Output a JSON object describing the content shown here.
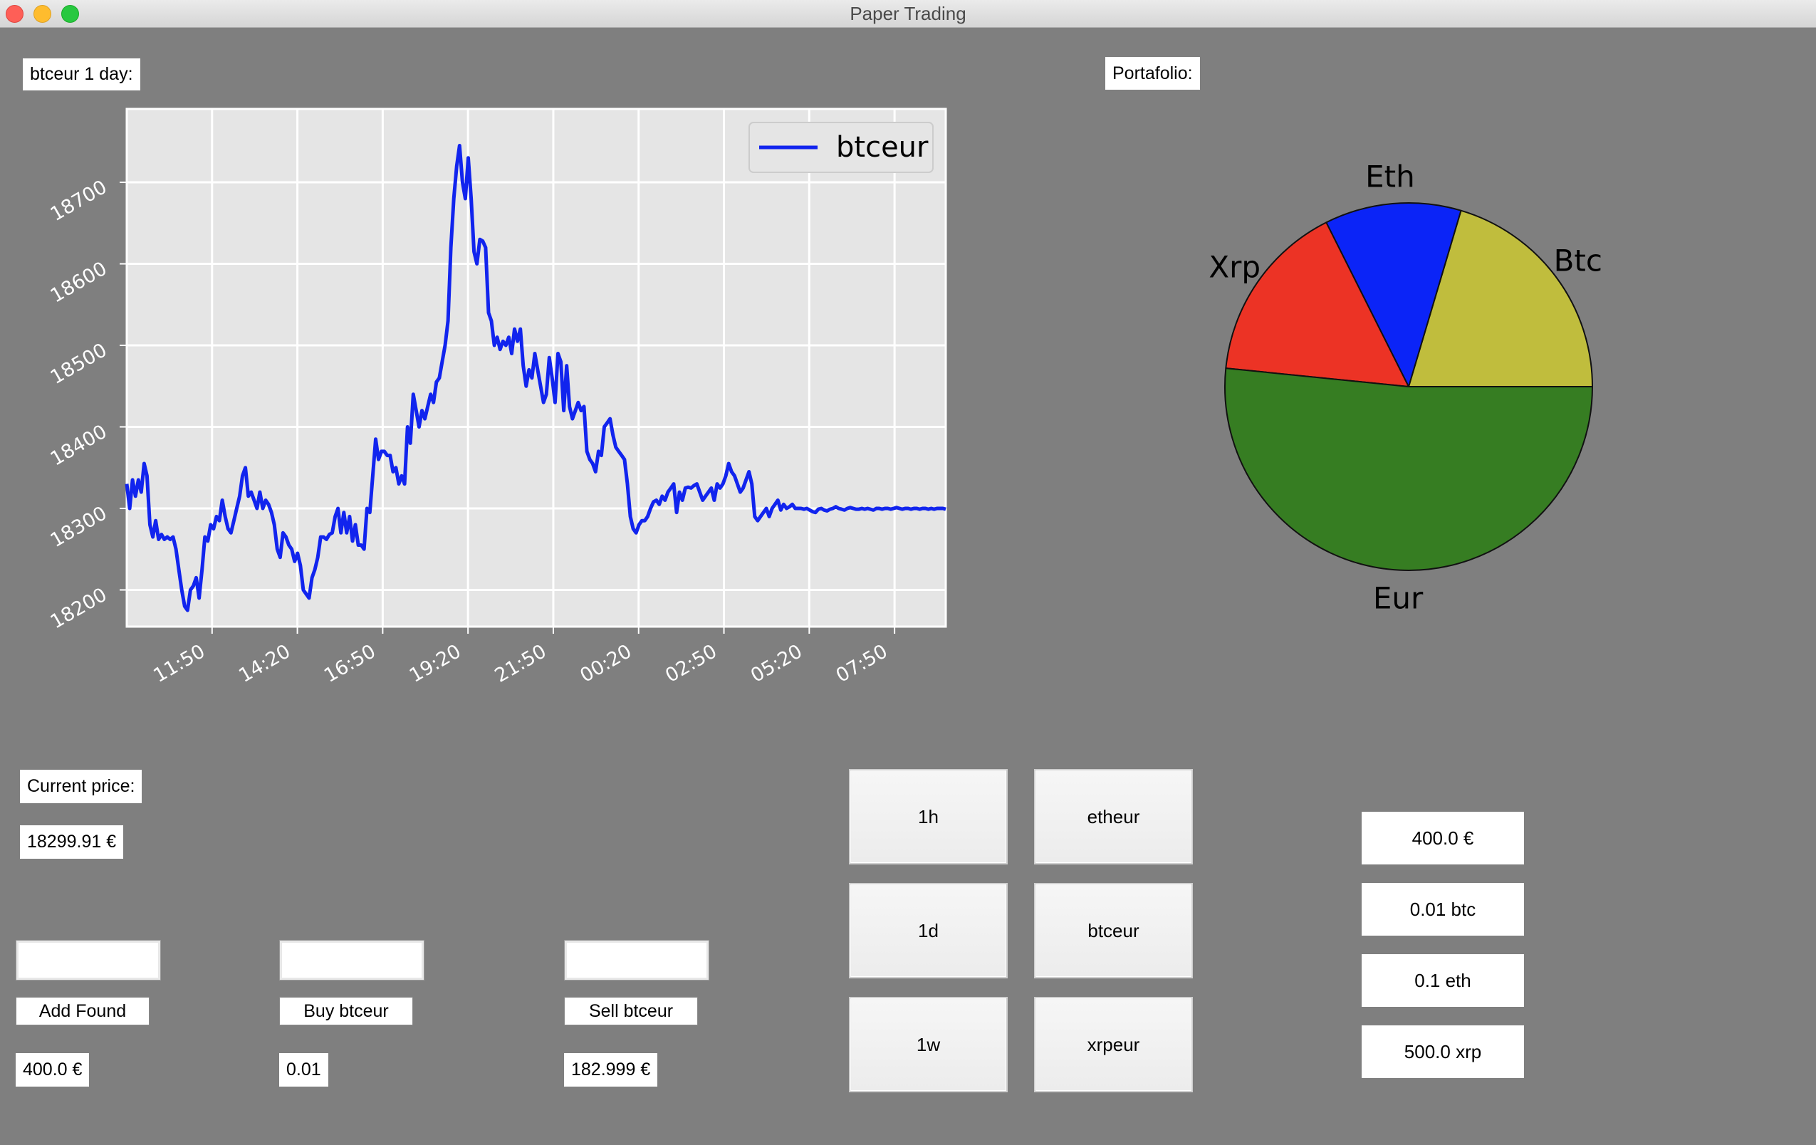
{
  "window": {
    "title": "Paper Trading"
  },
  "line_panel": {
    "label": "btceur 1 day:"
  },
  "portfolio_panel": {
    "label": "Portafolio:"
  },
  "price": {
    "label": "Current price:",
    "value": "18299.91 €"
  },
  "actions": {
    "fund": {
      "button": "Add Found",
      "value": "400.0 €",
      "input_value": ""
    },
    "buy": {
      "button": "Buy btceur",
      "value": "0.01",
      "input_value": ""
    },
    "sell": {
      "button": "Sell btceur",
      "value": "182.999 €",
      "input_value": ""
    }
  },
  "timeframes": [
    "1h",
    "1d",
    "1w"
  ],
  "pairs": [
    "etheur",
    "btceur",
    "xrpeur"
  ],
  "holdings": [
    "400.0 €",
    "0.01 btc",
    "0.1 eth",
    "500.0 xrp"
  ],
  "colors": {
    "background": "#7f7f7f",
    "plot_bg": "#e5e5e5",
    "line": "#1124ee",
    "eur": "#367d22",
    "xrp": "#ec3325",
    "eth": "#0b24f7",
    "btc": "#c0bd3d"
  },
  "chart_data": [
    {
      "type": "line",
      "title": "",
      "xlabel": "",
      "ylabel": "",
      "ylim": [
        18155,
        18790
      ],
      "yticks": [
        18200,
        18300,
        18400,
        18500,
        18600,
        18700
      ],
      "xlim": [
        0,
        288
      ],
      "x_ticks": [
        {
          "pos": 30,
          "label": "11:50"
        },
        {
          "pos": 60,
          "label": "14:20"
        },
        {
          "pos": 90,
          "label": "16:50"
        },
        {
          "pos": 120,
          "label": "19:20"
        },
        {
          "pos": 150,
          "label": "21:50"
        },
        {
          "pos": 180,
          "label": "00:20"
        },
        {
          "pos": 210,
          "label": "02:50"
        },
        {
          "pos": 240,
          "label": "05:20"
        },
        {
          "pos": 270,
          "label": "07:50"
        }
      ],
      "grid": true,
      "legend": "top-right",
      "series": [
        {
          "name": "btceur",
          "values": [
            18330,
            18300,
            18335,
            18315,
            18335,
            18320,
            18355,
            18340,
            18280,
            18265,
            18285,
            18262,
            18268,
            18262,
            18265,
            18262,
            18265,
            18250,
            18225,
            18200,
            18180,
            18175,
            18200,
            18205,
            18215,
            18190,
            18225,
            18265,
            18260,
            18280,
            18275,
            18290,
            18285,
            18310,
            18290,
            18275,
            18270,
            18285,
            18300,
            18315,
            18340,
            18350,
            18315,
            18320,
            18310,
            18300,
            18320,
            18300,
            18310,
            18305,
            18295,
            18280,
            18250,
            18240,
            18270,
            18265,
            18255,
            18250,
            18235,
            18245,
            18230,
            18200,
            18195,
            18190,
            18215,
            18225,
            18240,
            18265,
            18265,
            18262,
            18268,
            18270,
            18290,
            18300,
            18270,
            18295,
            18270,
            18290,
            18260,
            18280,
            18255,
            18255,
            18250,
            18300,
            18295,
            18340,
            18385,
            18360,
            18370,
            18370,
            18365,
            18365,
            18345,
            18350,
            18330,
            18340,
            18330,
            18400,
            18380,
            18440,
            18420,
            18400,
            18420,
            18410,
            18425,
            18440,
            18430,
            18455,
            18460,
            18480,
            18500,
            18530,
            18620,
            18680,
            18720,
            18745,
            18700,
            18680,
            18730,
            18680,
            18615,
            18600,
            18630,
            18628,
            18620,
            18540,
            18530,
            18500,
            18510,
            18495,
            18505,
            18500,
            18510,
            18490,
            18520,
            18505,
            18520,
            18475,
            18450,
            18470,
            18460,
            18490,
            18470,
            18450,
            18430,
            18440,
            18485,
            18460,
            18430,
            18490,
            18480,
            18420,
            18475,
            18425,
            18410,
            18420,
            18430,
            18420,
            18425,
            18370,
            18360,
            18355,
            18345,
            18370,
            18365,
            18400,
            18405,
            18410,
            18390,
            18375,
            18370,
            18365,
            18360,
            18330,
            18290,
            18275,
            18270,
            18280,
            18285,
            18285,
            18290,
            18300,
            18308,
            18310,
            18305,
            18315,
            18310,
            18320,
            18325,
            18330,
            18295,
            18320,
            18310,
            18325,
            18326,
            18325,
            18328,
            18330,
            18320,
            18310,
            18315,
            18320,
            18325,
            18310,
            18330,
            18325,
            18330,
            18340,
            18355,
            18345,
            18340,
            18330,
            18320,
            18325,
            18335,
            18345,
            18330,
            18290,
            18285,
            18290,
            18295,
            18300,
            18290,
            18300,
            18305,
            18310,
            18298,
            18305,
            18300,
            18302,
            18305,
            18300,
            18300,
            18300,
            18299,
            18300,
            18298,
            18296,
            18295,
            18299,
            18300,
            18298,
            18297,
            18299,
            18300,
            18302,
            18300,
            18299,
            18298,
            18300,
            18301,
            18300,
            18299,
            18299,
            18300,
            18299,
            18300,
            18299,
            18298,
            18300,
            18300,
            18299,
            18300,
            18300,
            18299,
            18300,
            18301,
            18300,
            18299,
            18300,
            18300,
            18299,
            18300,
            18300,
            18299,
            18300,
            18300,
            18299,
            18300,
            18299,
            18300,
            18300,
            18300,
            18299
          ]
        }
      ]
    },
    {
      "type": "pie",
      "title": "",
      "start_angle_deg": 0,
      "slices": [
        {
          "label": "Btc",
          "value": 20.4,
          "color": "#c0bd3d"
        },
        {
          "label": "Eth",
          "value": 12.0,
          "color": "#0b24f7"
        },
        {
          "label": "Xrp",
          "value": 16.0,
          "color": "#ec3325"
        },
        {
          "label": "Eur",
          "value": 51.6,
          "color": "#367d22"
        }
      ]
    }
  ]
}
